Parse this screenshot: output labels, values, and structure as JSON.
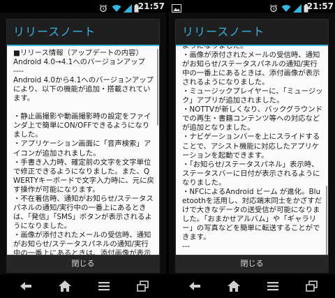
{
  "screens": [
    {
      "status_time": "21:57",
      "dialog_title": "リリースノート",
      "content_text": "■リリース情報（アップデートの内容）\nAndroid 4.0→4.1へのバージョンアップ\n----\nAndroid 4.0から4.1へのバージョンアップにより、以下の機能が追加・搭載されています。\n\n・静止画撮影や動画撮影時の設定をファインダ上で簡単にON/OFFできるようになりました。\n・アプリケーション画面に「音声検索」アイコンが追加されました。\n・手書き入力時、確定前の文字を文字単位で修正できるようになりました。また、QWERTYキーボードで文字入力時に、元に戻す操作が可能になります。\n・不在着信時、通知がお知らせ/ステータスパネルの通知/実行中の一番上にあるときは、「発信」「SMS」ボタンが表示されるようになりました。\n・画像が添付されたメールの受信時、通知がお知らせ/ステータスパネルの通知/実行中の一番上にあるときは、添付画像が表示",
      "close_label": "閉じる"
    },
    {
      "status_time": "21:57",
      "dialog_title": "リリースノート",
      "content_text": "ようになりました。\n・画像が添付されたメールの受信時、通知がお知らせ/ステータスパネルの通知/実行中の一番上にあるときは、添付画像が表示されるようになりました。\n・ミュージックプレイヤーに、「ミュージック」アプリが追加されました。\n・NOTTVが新しくなり、バックグラウンドでの再生・書籍コンテンツ等への対応などが追加となりました。\n・ナビゲーションバーを上にスライドすることで、アシスト機能に対応したアプリケーションを起動できます。\n・「お知らせ/ステータスパネル」表示時、ステータスバーに日付が表示されるようになりました。\n・NFCによるAndroid ビーム が進化。Bluetoothを活用し、対応端末同士をかざすだけで大きなデータの送受信が可能になりました。「おまかせアルバム」や「ギャラリー」の写真などを簡単に転送することができます。\n---",
      "close_label": "閉じる"
    }
  ],
  "colors": {
    "accent": "#33b5e5",
    "dialog_bg": "#1f1f1f",
    "content_bg": "#fbfbfb"
  }
}
